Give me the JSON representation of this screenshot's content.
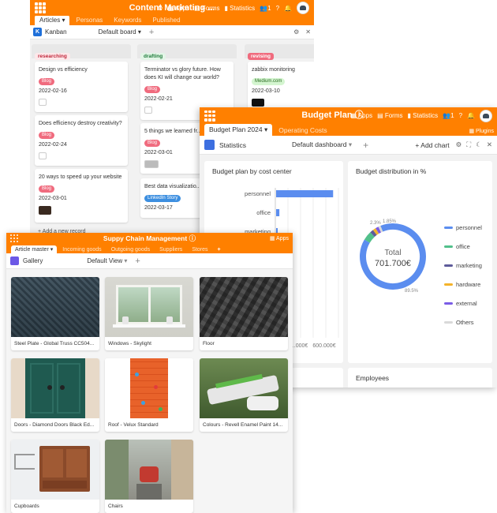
{
  "kanban_window": {
    "title": "Content Marketing ...",
    "apps_label": "Apps",
    "forms_label": "Forms",
    "statistics_label": "Statistics",
    "collaborators": "1",
    "tabs": [
      "Articles",
      "Personas",
      "Keywords",
      "Published"
    ],
    "view_name": "Kanban",
    "board_name": "Default board",
    "columns": [
      {
        "label": "researching",
        "color": "#fde8ea",
        "text_color": "#c0273b",
        "cards": [
          {
            "title": "Design vs efficiency",
            "tag": "Blog",
            "date": "2022-02-16"
          },
          {
            "title": "Does efficiency destroy creativity?",
            "tag": "Blog",
            "date": "2022-02-24"
          },
          {
            "title": "20 ways to speed up your website",
            "tag": "Blog",
            "date": "2022-03-01"
          }
        ],
        "add_label": "+ Add a new record"
      },
      {
        "label": "drafting",
        "color": "#e2f5e6",
        "text_color": "#1f7a3a",
        "cards": [
          {
            "title": "Terminator vs glory future. How does KI will change our world?",
            "tag": "Blog",
            "date": "2022-02-21"
          },
          {
            "title": "5 things we learned fr...",
            "tag": "Blog",
            "date": "2022-03-01"
          },
          {
            "title": "Best data visualizatio...",
            "tag": "LinkedIn Story",
            "date": "2022-03-17"
          }
        ]
      },
      {
        "label": "revising",
        "color": "#f06b7e",
        "text_color": "#ffffff",
        "cards": [
          {
            "title": "zabbix monitoring",
            "tag": "Medium.com",
            "date": "2022-03-10"
          }
        ]
      }
    ]
  },
  "budget_window": {
    "title": "Budget Plan",
    "apps_label": "Apps",
    "forms_label": "Forms",
    "statistics_label": "Statistics",
    "collaborators": "1",
    "plugins_label": "Plugins",
    "tabs": [
      "Budget Plan 2024",
      "Operating Costs"
    ],
    "view_name": "Statistics",
    "dashboard_name": "Default dashboard",
    "add_chart_label": "+ Add chart",
    "panels": {
      "bar_title": "Budget plan by cost center",
      "donut_title": "Budget distribution in %",
      "employees_title": "Employees"
    },
    "colors": {
      "personnel": "#5b8def",
      "office": "#52c08b",
      "marketing": "#5e5b9a",
      "hardware": "#f4b32a",
      "external": "#7a5ce6",
      "others": "#d9d9d9"
    }
  },
  "chart_data": [
    {
      "type": "bar",
      "title": "Budget plan by cost center",
      "orientation": "horizontal",
      "categories": [
        "personnel",
        "office",
        "marketing"
      ],
      "values": [
        560000,
        32000,
        12000
      ],
      "tick_labels": [
        "…000€",
        "600.000€"
      ],
      "xlim": [
        0,
        620000
      ]
    },
    {
      "type": "pie",
      "title": "Budget distribution in %",
      "center_label": "Total",
      "center_value": "701.700€",
      "series": [
        {
          "name": "personnel",
          "value": 89.5
        },
        {
          "name": "office",
          "value": 4.5
        },
        {
          "name": "marketing",
          "value": 1.7
        },
        {
          "name": "hardware",
          "value": 1.5
        },
        {
          "name": "external",
          "value": 1.5
        },
        {
          "name": "Others",
          "value": 1.3
        }
      ],
      "data_labels": [
        "89.5%",
        "2.3%",
        "1.85%"
      ]
    }
  ],
  "supply_window": {
    "title": "Suppy Chain Management",
    "apps_label": "Apps",
    "tabs": [
      "Article master",
      "Incoming goods",
      "Outgoing goods",
      "Suppliers",
      "Stores"
    ],
    "view_name": "Gallery",
    "view_selector": "Default View",
    "items": [
      {
        "caption": "Steel Plate - Global Truss CC504..."
      },
      {
        "caption": "Windows - Skylight"
      },
      {
        "caption": "Floor"
      },
      {
        "caption": "Doors - Diamond Doors Black Ed..."
      },
      {
        "caption": "Roof - Velux Standard"
      },
      {
        "caption": "Colours - Revell Enamel Paint 14..."
      },
      {
        "caption": "Cupboards"
      },
      {
        "caption": "Chairs"
      }
    ]
  }
}
